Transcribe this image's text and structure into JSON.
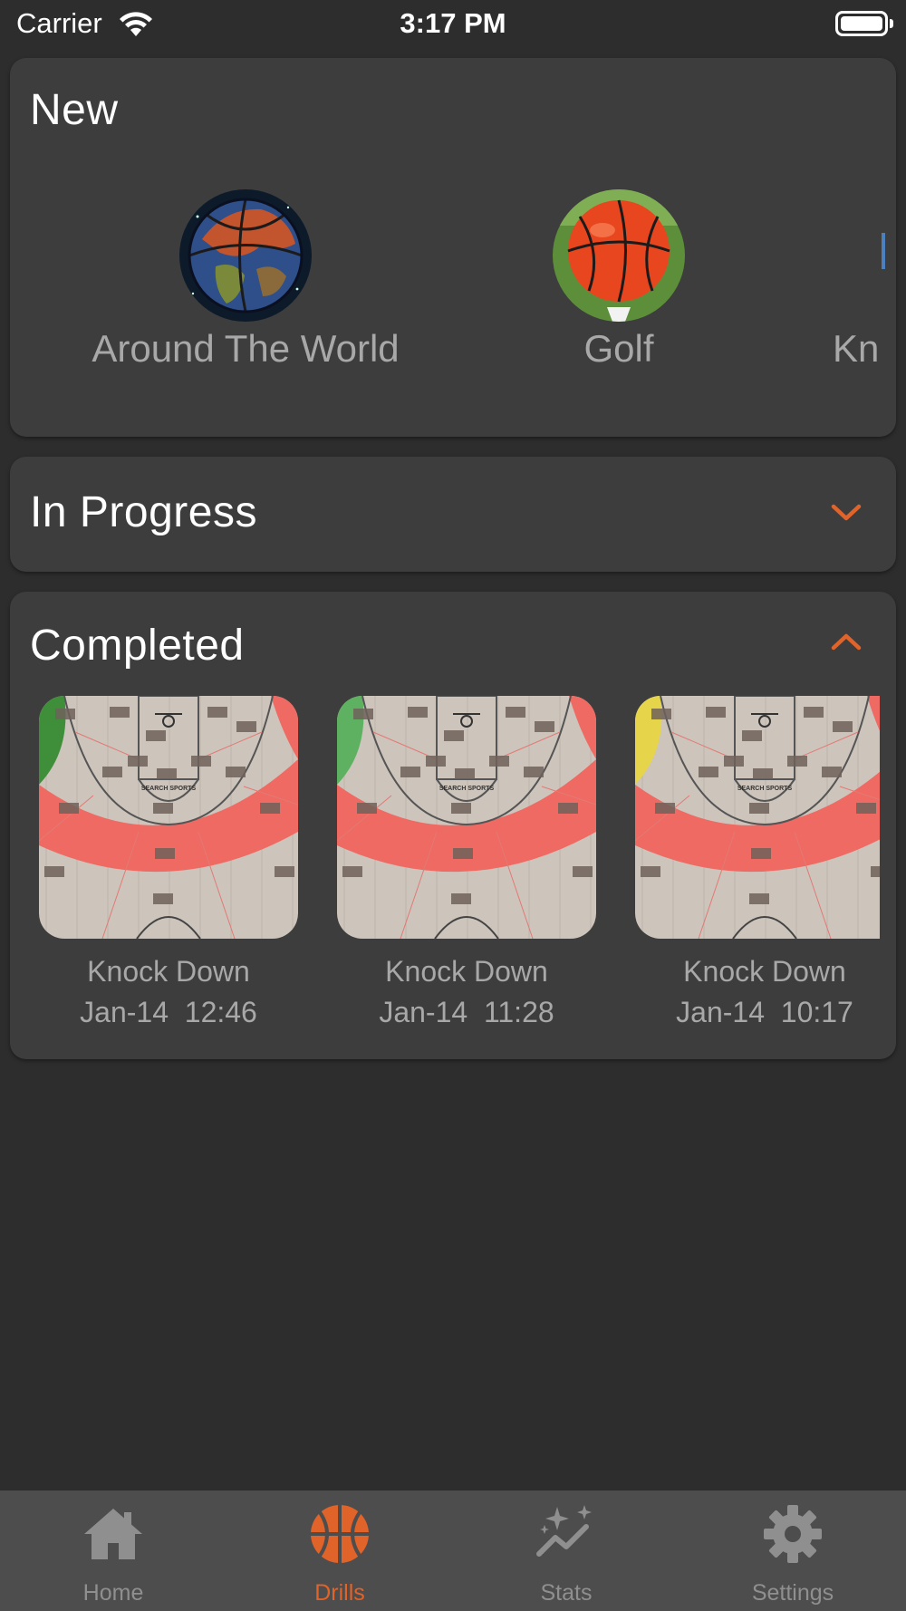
{
  "status_bar": {
    "carrier": "Carrier",
    "time": "3:17 PM"
  },
  "sections": {
    "new": {
      "title": "New",
      "items": [
        {
          "label": "Around The World",
          "icon": "earth-basketball-image"
        },
        {
          "label": "Golf",
          "icon": "basketball-on-golf-tee-image"
        },
        {
          "label": "Kn",
          "icon": "drill-image"
        }
      ]
    },
    "in_progress": {
      "title": "In Progress",
      "expanded": false
    },
    "completed": {
      "title": "Completed",
      "expanded": true,
      "items": [
        {
          "name": "Knock Down",
          "date": "Jan-14",
          "time": "12:46",
          "corner_color": "#3f8f3a",
          "logo": "SEARCH SPORTS"
        },
        {
          "name": "Knock Down",
          "date": "Jan-14",
          "time": "11:28",
          "corner_color": "#5eb160",
          "logo": "SEARCH SPORTS"
        },
        {
          "name": "Knock Down",
          "date": "Jan-14",
          "time": "10:17",
          "corner_color": "#e6d54a",
          "logo": "SEARCH SPORTS"
        }
      ]
    }
  },
  "tab_bar": {
    "active": "Drills",
    "tabs": [
      {
        "label": "Home",
        "icon": "house-icon"
      },
      {
        "label": "Drills",
        "icon": "basketball-icon"
      },
      {
        "label": "Stats",
        "icon": "sparkle-chart-icon"
      },
      {
        "label": "Settings",
        "icon": "gear-icon"
      }
    ]
  },
  "colors": {
    "accent": "#e0632a",
    "background": "#2d2d2d",
    "card": "#3d3d3d",
    "tab_bar": "#4d4d4d",
    "zone_red": "#ee6a62"
  }
}
